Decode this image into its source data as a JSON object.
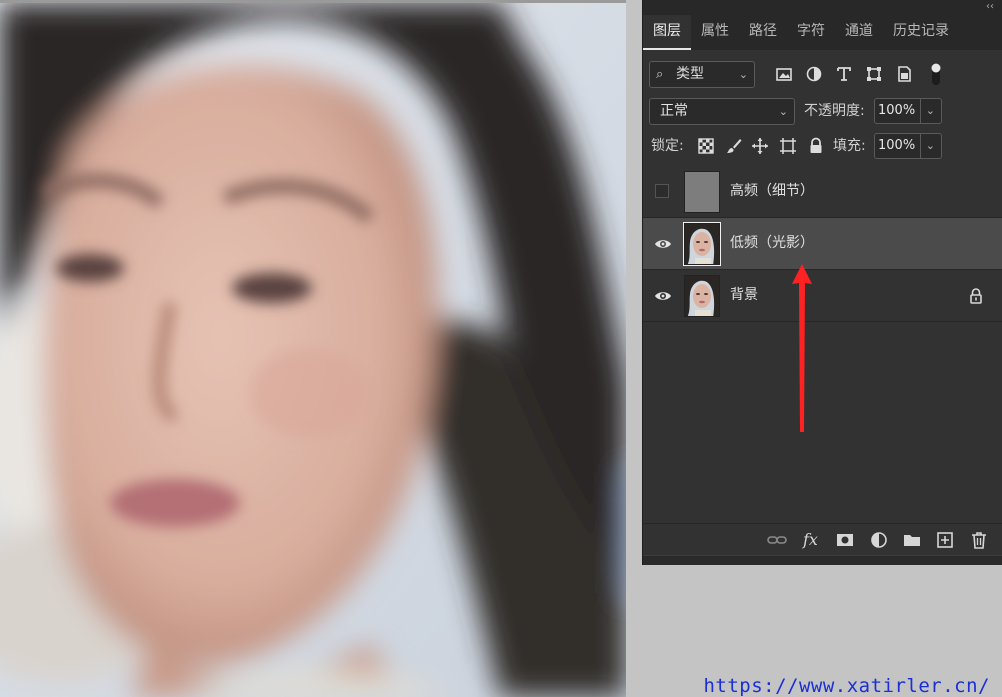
{
  "panel": {
    "collapse_glyph": "‹‹",
    "tabs": [
      {
        "label": "图层",
        "active": true
      },
      {
        "label": "属性"
      },
      {
        "label": "路径"
      },
      {
        "label": "字符"
      },
      {
        "label": "通道"
      },
      {
        "label": "历史记录"
      }
    ],
    "filter": {
      "label": "类型",
      "icons": [
        "image-filter-icon",
        "adjustment-filter-icon",
        "type-filter-icon",
        "shape-filter-icon",
        "smart-object-filter-icon",
        "filter-toggle-icon"
      ]
    },
    "blend_mode": "正常",
    "opacity_label": "不透明度:",
    "opacity_value": "100%",
    "lock_label": "锁定:",
    "lock_icons": [
      "lock-transparent-icon",
      "lock-paint-icon",
      "lock-position-icon",
      "lock-artboard-icon",
      "lock-all-icon"
    ],
    "fill_label": "填充:",
    "fill_value": "100%",
    "layers": [
      {
        "name": "高频（细节）",
        "visible": false,
        "selected": false,
        "locked": false,
        "thumb": "gray"
      },
      {
        "name": "低频（光影）",
        "visible": true,
        "selected": true,
        "locked": false,
        "thumb": "portrait"
      },
      {
        "name": "背景",
        "visible": true,
        "selected": false,
        "locked": true,
        "thumb": "portrait"
      }
    ],
    "bottom_icons": [
      "link-layers-icon",
      "fx-icon",
      "mask-icon",
      "adjustment-layer-icon",
      "group-folder-icon",
      "new-layer-icon",
      "delete-icon"
    ],
    "fx_label": "fx"
  },
  "watermark": "https://www.xatirler.cn/",
  "colors": {
    "annotation_arrow": "#ff2222",
    "panel_bg": "#323232",
    "selected_row": "#4b4b4b"
  }
}
